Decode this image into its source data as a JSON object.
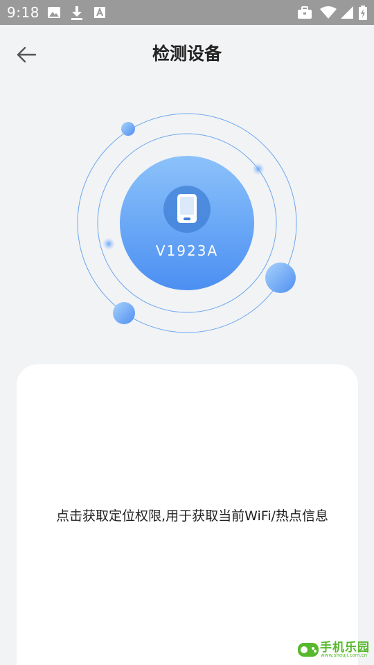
{
  "status_bar": {
    "time": "9:18",
    "left_icons": [
      "image-icon",
      "download-icon",
      "font-a-icon"
    ],
    "right_icons": [
      "briefcase-icon",
      "wifi-icon",
      "signal-icon",
      "battery-charging-icon"
    ]
  },
  "header": {
    "title": "检测设备",
    "back_icon": "arrow-left-icon"
  },
  "device": {
    "model": "V1923A",
    "icon": "phone-icon"
  },
  "card": {
    "instruction": "点击获取定位权限,用于获取当前WiFi/热点信息"
  },
  "watermark": {
    "title": "手机乐园",
    "subtitle": "www.shouji.com.cn"
  },
  "colors": {
    "background": "#f2f3f5",
    "status_bar": "#9a9a9a",
    "accent_blue": "#5b9cf5",
    "orbit_line": "#6aa6f0",
    "card": "#ffffff",
    "watermark_green": "#57b82c"
  }
}
